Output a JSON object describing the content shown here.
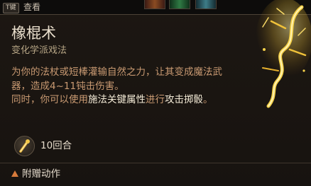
{
  "topbar": {
    "key_badge": "T键",
    "view_label": "查看",
    "icons": [
      "ability-icon-red",
      "ability-icon-green",
      "ability-icon-teal"
    ]
  },
  "spell": {
    "name": "橡棍术",
    "school": "变化学派戏法",
    "description": {
      "part1": "为你的法杖或短棒灌输自然之力，让其变成魔法武器，造成4~11钝击伤害。",
      "part2": "同时，你可以使用",
      "highlight1": "施法关键属性",
      "part3": "进行",
      "highlight2": "攻击掷骰",
      "part4": "。"
    },
    "duration": "10回合",
    "bonus_action": "附赠动作"
  },
  "colors": {
    "background": "#1a1511",
    "title": "#eadfcd",
    "school": "#b7a686",
    "description": "#c99a72",
    "highlight": "#f3ead6",
    "accent": "#d77a3b",
    "illustration_glow": "#f0c23a"
  },
  "icons": {
    "duration": "club-glow-icon",
    "bonus_action": "warning-triangle-icon",
    "illustration": "glowing-staff-icon"
  }
}
